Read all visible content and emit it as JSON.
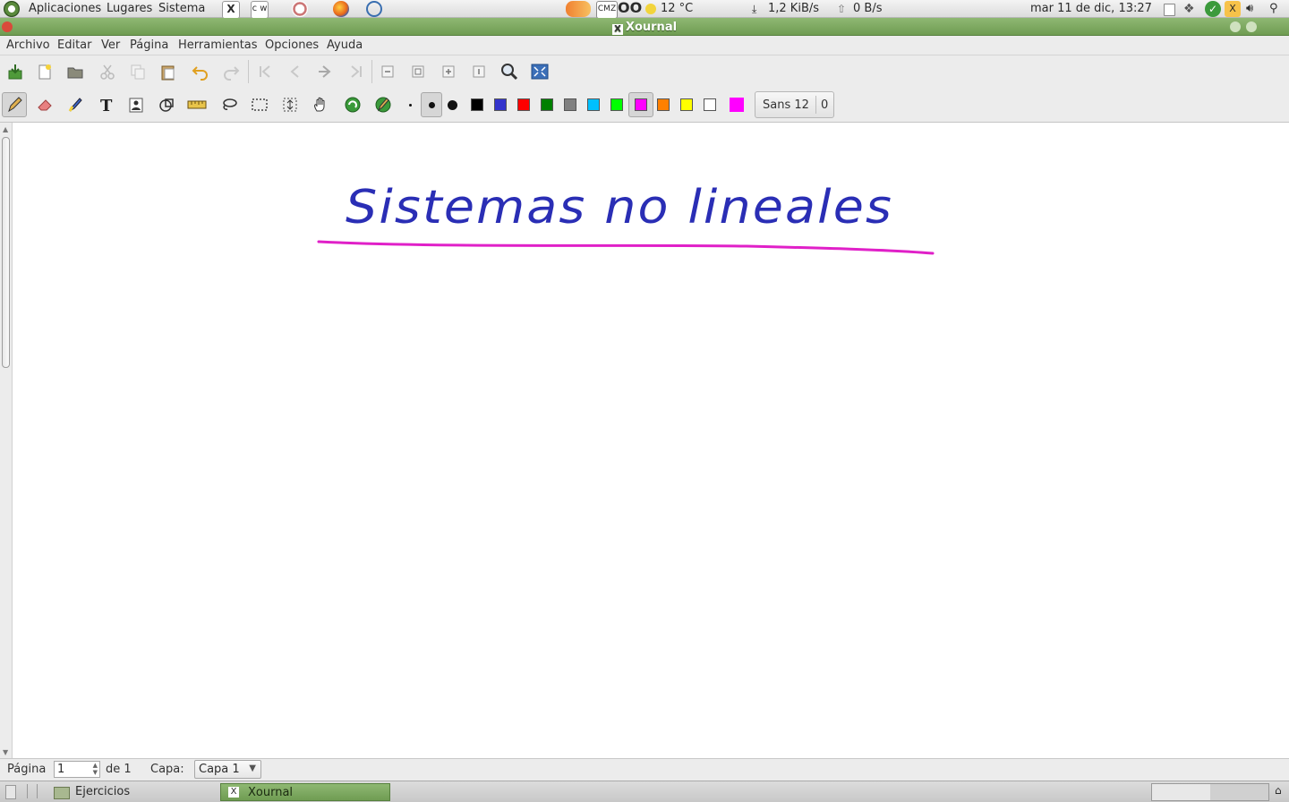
{
  "top_panel": {
    "menus": [
      "Aplicaciones",
      "Lugares",
      "Sistema"
    ],
    "weather": "12 °C",
    "net_down": "1,2 KiB/s",
    "net_up": "0 B/s",
    "clock": "mar 11 de dic, 13:27"
  },
  "window": {
    "title": "Xournal"
  },
  "menubar": [
    "Archivo",
    "Editar",
    "Ver",
    "Página",
    "Herramientas",
    "Opciones",
    "Ayuda"
  ],
  "toolbar": {
    "font_name": "Sans 12",
    "font_size_field": "0",
    "colors": [
      "#000000",
      "#3333cc",
      "#ff0000",
      "#008000",
      "#808080",
      "#00c0ff",
      "#00ff00",
      "#ff00ff",
      "#ff8000",
      "#ffff00",
      "#ffffff",
      "#ff00ff"
    ]
  },
  "page_content": {
    "title_text": "Sistemas no lineales",
    "ink_color": "#2a2eb5",
    "underline_color": "#e020c8"
  },
  "statusbar": {
    "page_label": "Página",
    "page_value": "1",
    "page_total": "de 1",
    "layer_label": "Capa:",
    "layer_value": "Capa 1"
  },
  "taskbar": {
    "items": [
      "Ejercicios",
      "Xournal"
    ]
  }
}
